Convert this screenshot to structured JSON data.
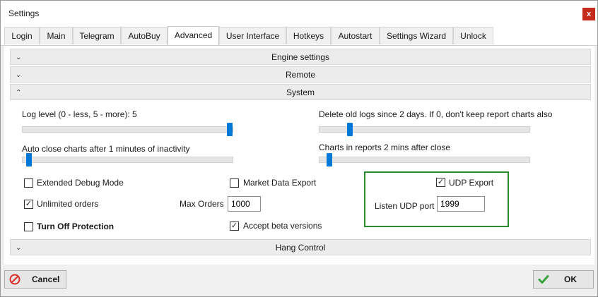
{
  "window": {
    "title": "Settings",
    "close_label": "x"
  },
  "tabs": [
    {
      "label": "Login"
    },
    {
      "label": "Main"
    },
    {
      "label": "Telegram"
    },
    {
      "label": "AutoBuy"
    },
    {
      "label": "Advanced"
    },
    {
      "label": "User Interface"
    },
    {
      "label": "Hotkeys"
    },
    {
      "label": "Autostart"
    },
    {
      "label": "Settings Wizard"
    },
    {
      "label": "Unlock"
    }
  ],
  "active_tab": "Advanced",
  "groups": {
    "engine": {
      "label": "Engine settings",
      "expanded": false
    },
    "remote": {
      "label": "Remote",
      "expanded": false
    },
    "system": {
      "label": "System",
      "expanded": true
    },
    "hang": {
      "label": "Hang Control",
      "expanded": false
    }
  },
  "sliders": {
    "log_level": {
      "label": "Log level (0 - less, 5 - more):  5",
      "min": 0,
      "max": 5,
      "value": 5
    },
    "delete_logs": {
      "label": "Delete old logs since 2 days. If 0, don't keep report charts also",
      "value_fraction": 0.14
    },
    "auto_close": {
      "label": "Auto close charts after 1 minutes of inactivity",
      "value_fraction": 0.02
    },
    "charts_reports": {
      "label": "Charts in reports 2 mins after close",
      "value_fraction": 0.04
    }
  },
  "checks": {
    "extended_debug": {
      "label": "Extended Debug Mode",
      "checked": false
    },
    "market_data_export": {
      "label": "Market Data Export",
      "checked": false
    },
    "udp_export": {
      "label": "UDP Export",
      "checked": true
    },
    "unlimited_orders": {
      "label": "Unlimited orders",
      "checked": true
    },
    "turn_off_protection": {
      "label": "Turn Off Protection",
      "checked": false
    },
    "accept_beta": {
      "label": "Accept beta versions",
      "checked": true
    }
  },
  "fields": {
    "max_orders": {
      "label": "Max Orders",
      "value": "1000"
    },
    "listen_udp_port": {
      "label": "Listen UDP port",
      "value": "1999"
    }
  },
  "buttons": {
    "cancel": {
      "label": "Cancel",
      "icon": "no-entry-icon"
    },
    "ok": {
      "label": "OK",
      "icon": "check-icon"
    }
  },
  "colors": {
    "accent": "#0078d7",
    "highlight_border": "#2d8a2d",
    "close_red": "#c42b1c",
    "ok_green": "#3aa23a",
    "cancel_red": "#d9302a"
  }
}
